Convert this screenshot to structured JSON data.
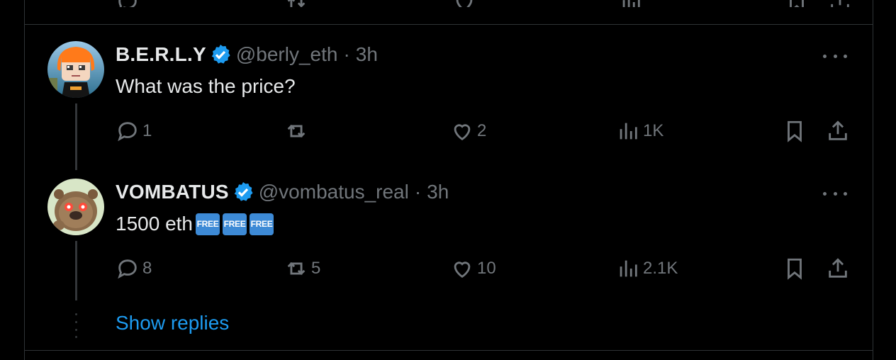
{
  "tweets": [
    {
      "name": "B.E.R.L.Y",
      "handle": "@berly_eth",
      "separator": "·",
      "time": "3h",
      "text": "What was the price?",
      "emoji": [],
      "replies": "1",
      "reposts": "",
      "likes": "2",
      "views": "1K"
    },
    {
      "name": "VOMBATUS",
      "handle": "@vombatus_real",
      "separator": "·",
      "time": "3h",
      "text": "1500 eth",
      "emoji": [
        "FREE",
        "FREE",
        "FREE"
      ],
      "replies": "8",
      "reposts": "5",
      "likes": "10",
      "views": "2.1K"
    }
  ],
  "show_replies": "Show replies",
  "colors": {
    "accent": "#1d9bf0",
    "muted": "#71767b",
    "border": "#2f3336",
    "text": "#e7e9ea"
  },
  "icons": [
    "reply-icon",
    "repost-icon",
    "like-icon",
    "views-icon",
    "bookmark-icon",
    "share-icon",
    "verified-badge-icon",
    "more-icon"
  ]
}
